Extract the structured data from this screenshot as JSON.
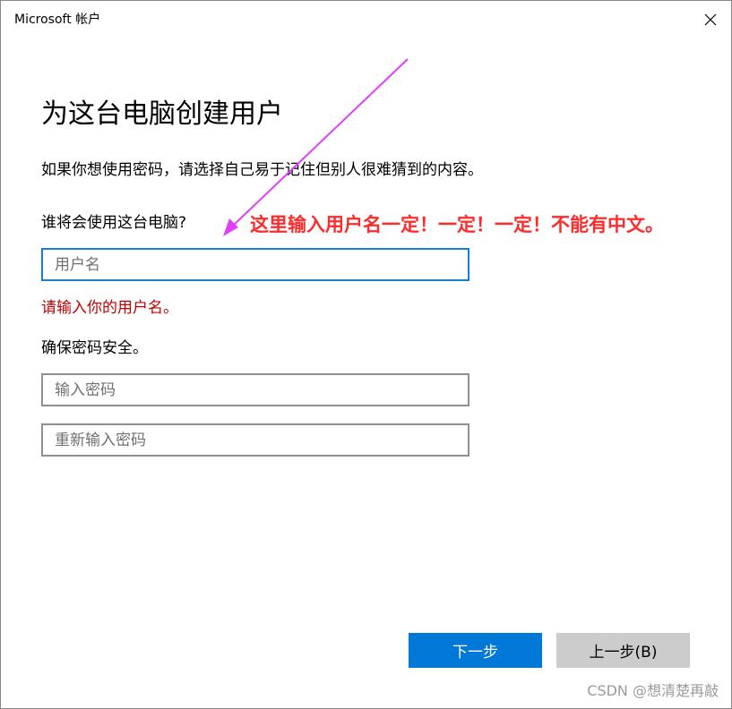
{
  "window": {
    "title": "Microsoft 帐户"
  },
  "page": {
    "title": "为这台电脑创建用户",
    "description": "如果你想使用密码，请选择自己易于记住但别人很难猜到的内容。",
    "who_label": "谁将会使用这台电脑?",
    "username_placeholder": "用户名",
    "username_value": "",
    "error_message": "请输入你的用户名。",
    "secure_label": "确保密码安全。",
    "password_placeholder": "输入密码",
    "password_value": "",
    "password_confirm_placeholder": "重新输入密码",
    "password_confirm_value": ""
  },
  "buttons": {
    "next_label": "下一步",
    "back_label": "上一步(B)"
  },
  "annotation": {
    "text": "这里输入用户名一定！一定！一定！不能有中文。",
    "color": "#ff2b2b",
    "arrow_color": "#e040fb"
  },
  "watermark": {
    "text": "CSDN @想清楚再敲"
  },
  "colors": {
    "accent": "#0078d7",
    "focus_border": "#1a7cd6",
    "error": "#c20000",
    "secondary_button": "#cccccc"
  },
  "icons": {
    "close": "close-icon"
  }
}
